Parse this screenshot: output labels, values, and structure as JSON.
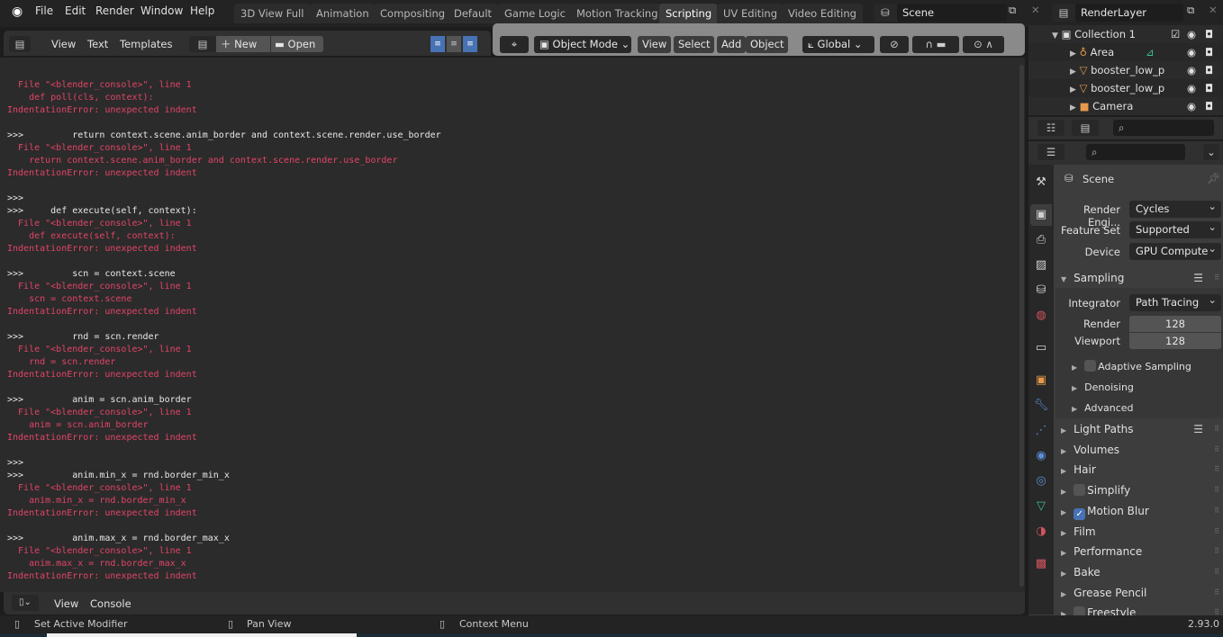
{
  "topbar": {
    "menus": [
      "File",
      "Edit",
      "Render",
      "Window",
      "Help"
    ],
    "workspaces": [
      "3D View Full",
      "Animation",
      "Compositing",
      "Default",
      "Game Logic",
      "Motion Tracking",
      "Scripting",
      "UV Editing",
      "Video Editing"
    ],
    "active_workspace": "Scripting",
    "scene": "Scene",
    "render_layer": "RenderLayer"
  },
  "text_editor": {
    "menus": [
      "View",
      "Text",
      "Templates"
    ],
    "new_label": "New",
    "open_label": "Open"
  },
  "viewport": {
    "mode": "Object Mode",
    "menus": [
      "View",
      "Select",
      "Add",
      "Object"
    ],
    "orientation": "Global"
  },
  "console": {
    "lines": [
      {
        "t": "err",
        "s": "  File \"<blender_console>\", line 1"
      },
      {
        "t": "err",
        "s": "    def poll(cls, context):"
      },
      {
        "t": "err",
        "s": "IndentationError: unexpected indent"
      },
      {
        "t": "blank",
        "s": ""
      },
      {
        "t": "in",
        "s": ">>>         return context.scene.anim_border and context.scene.render.use_border"
      },
      {
        "t": "err",
        "s": "  File \"<blender_console>\", line 1"
      },
      {
        "t": "err",
        "s": "    return context.scene.anim_border and context.scene.render.use_border"
      },
      {
        "t": "err",
        "s": "IndentationError: unexpected indent"
      },
      {
        "t": "blank",
        "s": ""
      },
      {
        "t": "in",
        "s": ">>> "
      },
      {
        "t": "in",
        "s": ">>>     def execute(self, context):"
      },
      {
        "t": "err",
        "s": "  File \"<blender_console>\", line 1"
      },
      {
        "t": "err",
        "s": "    def execute(self, context):"
      },
      {
        "t": "err",
        "s": "IndentationError: unexpected indent"
      },
      {
        "t": "blank",
        "s": ""
      },
      {
        "t": "in",
        "s": ">>>         scn = context.scene"
      },
      {
        "t": "err",
        "s": "  File \"<blender_console>\", line 1"
      },
      {
        "t": "err",
        "s": "    scn = context.scene"
      },
      {
        "t": "err",
        "s": "IndentationError: unexpected indent"
      },
      {
        "t": "blank",
        "s": ""
      },
      {
        "t": "in",
        "s": ">>>         rnd = scn.render"
      },
      {
        "t": "err",
        "s": "  File \"<blender_console>\", line 1"
      },
      {
        "t": "err",
        "s": "    rnd = scn.render"
      },
      {
        "t": "err",
        "s": "IndentationError: unexpected indent"
      },
      {
        "t": "blank",
        "s": ""
      },
      {
        "t": "in",
        "s": ">>>         anim = scn.anim_border"
      },
      {
        "t": "err",
        "s": "  File \"<blender_console>\", line 1"
      },
      {
        "t": "err",
        "s": "    anim = scn.anim_border"
      },
      {
        "t": "err",
        "s": "IndentationError: unexpected indent"
      },
      {
        "t": "blank",
        "s": ""
      },
      {
        "t": "in",
        "s": ">>> "
      },
      {
        "t": "in",
        "s": ">>>         anim.min_x = rnd.border_min_x"
      },
      {
        "t": "err",
        "s": "  File \"<blender_console>\", line 1"
      },
      {
        "t": "err",
        "s": "    anim.min_x = rnd.border_min_x"
      },
      {
        "t": "err",
        "s": "IndentationError: unexpected indent"
      },
      {
        "t": "blank",
        "s": ""
      },
      {
        "t": "in",
        "s": ">>>         anim.max_x = rnd.border_max_x"
      },
      {
        "t": "err",
        "s": "  File \"<blender_console>\", line 1"
      },
      {
        "t": "err",
        "s": "    anim.max_x = rnd.border_max_x"
      },
      {
        "t": "err",
        "s": "IndentationError: unexpected indent"
      }
    ],
    "colors": {
      "input": "#e8e8e8",
      "error": "#e24468"
    },
    "header_menus": [
      "View",
      "Console"
    ]
  },
  "outliner": {
    "items": [
      {
        "label": "Collection 1",
        "icon": "collection-icon"
      },
      {
        "label": "Area",
        "icon": "light-icon"
      },
      {
        "label": "booster_low_p",
        "icon": "mesh-icon"
      },
      {
        "label": "booster_low_p",
        "icon": "mesh-icon"
      },
      {
        "label": "Camera",
        "icon": "camera-icon"
      }
    ]
  },
  "properties": {
    "context": "Scene",
    "render_engine_label": "Render Engi...",
    "render_engine": "Cycles",
    "feature_set_label": "Feature Set",
    "feature_set": "Supported",
    "device_label": "Device",
    "device": "GPU Compute",
    "sampling": {
      "title": "Sampling",
      "integrator_label": "Integrator",
      "integrator": "Path Tracing",
      "render_label": "Render",
      "render": "128",
      "viewport_label": "Viewport",
      "viewport": "128",
      "subpanels": [
        "Adaptive Sampling",
        "Denoising",
        "Advanced"
      ]
    },
    "sections": [
      {
        "label": "Light Paths",
        "checkbox": null
      },
      {
        "label": "Volumes",
        "checkbox": null
      },
      {
        "label": "Hair",
        "checkbox": null
      },
      {
        "label": "Simplify",
        "checkbox": false
      },
      {
        "label": "Motion Blur",
        "checkbox": true
      },
      {
        "label": "Film",
        "checkbox": null
      },
      {
        "label": "Performance",
        "checkbox": null
      },
      {
        "label": "Bake",
        "checkbox": null
      },
      {
        "label": "Grease Pencil",
        "checkbox": null
      },
      {
        "label": "Freestyle",
        "checkbox": false
      }
    ]
  },
  "status": {
    "left": "Set Active Modifier",
    "middle": "Pan View",
    "right": "Context Menu",
    "version": "2.93.0"
  }
}
